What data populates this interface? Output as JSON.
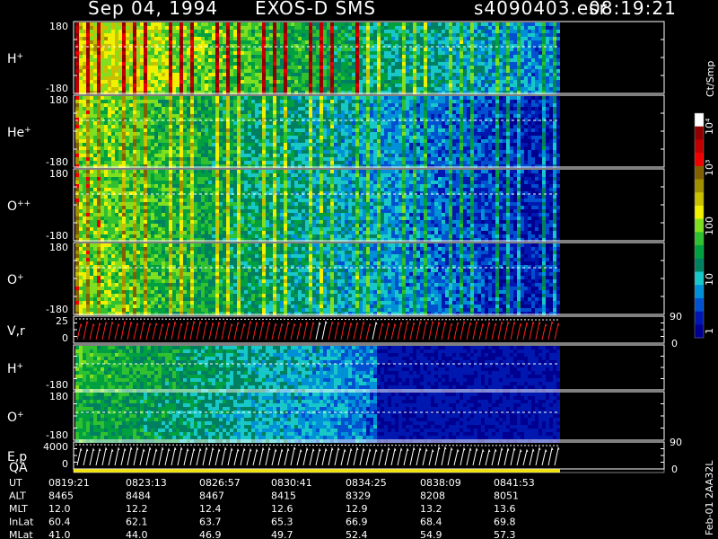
{
  "header": {
    "date": "Sep 04, 1994",
    "mission": "EXOS-D SMS",
    "file": "s4090403.esr",
    "time": "08:19:21"
  },
  "colorbar": {
    "unit": "Ct/Smp",
    "ticks": [
      "10⁴",
      "10³",
      "100",
      "10",
      "1"
    ],
    "colors": [
      "#000090",
      "#0018b0",
      "#0050d0",
      "#0090d8",
      "#18c8c8",
      "#008060",
      "#00a040",
      "#30c030",
      "#80e020",
      "#f0f000",
      "#c8c000",
      "#a09000",
      "#806000",
      "#f00000",
      "#c00000",
      "#900000",
      "#ffffff"
    ]
  },
  "panels": [
    {
      "label": "H",
      "sup": "+",
      "top_tick": "180",
      "bottom_tick": "-180"
    },
    {
      "label": "He",
      "sup": "+",
      "top_tick": "180",
      "bottom_tick": "-180"
    },
    {
      "label": "O",
      "sup": "++",
      "top_tick": "180",
      "bottom_tick": "-180"
    },
    {
      "label": "O",
      "sup": "+",
      "top_tick": "180",
      "bottom_tick": "-180"
    },
    {
      "label": "V,r",
      "sup": "",
      "top_tick": "25",
      "bottom_tick": "0",
      "right_top": "90",
      "right_bottom": "0"
    },
    {
      "label": "H",
      "sup": "+",
      "top_tick": "",
      "bottom_tick": "-180"
    },
    {
      "label": "O",
      "sup": "+",
      "top_tick": "180",
      "bottom_tick": "-180"
    },
    {
      "label": "E,p",
      "sup": "",
      "top_tick": "4000",
      "bottom_tick": "0",
      "right_top": "90",
      "right_bottom": "0"
    }
  ],
  "qa_label": "QA",
  "orbit_table": {
    "rows": [
      {
        "name": "UT",
        "values": [
          "0819:21",
          "0823:13",
          "0826:57",
          "0830:41",
          "0834:25",
          "0838:09",
          "0841:53"
        ]
      },
      {
        "name": "ALT",
        "values": [
          "8465",
          "8484",
          "8467",
          "8415",
          "8329",
          "8208",
          "8051"
        ]
      },
      {
        "name": "MLT",
        "values": [
          "12.0",
          "12.2",
          "12.4",
          "12.6",
          "12.9",
          "13.2",
          "13.6"
        ]
      },
      {
        "name": "InLat",
        "values": [
          "60.4",
          "62.1",
          "63.7",
          "65.3",
          "66.9",
          "68.4",
          "69.8"
        ]
      },
      {
        "name": "MLat",
        "values": [
          "41.0",
          "44.0",
          "46.9",
          "49.7",
          "52.4",
          "54.9",
          "57.3"
        ]
      }
    ]
  },
  "side_note": "Feb-01 2AA32L",
  "chart_data": {
    "type": "heatmap",
    "title": "Sep 04, 1994 EXOS-D SMS",
    "x": [
      "0819:21",
      "0823:13",
      "0826:57",
      "0830:41",
      "0834:25",
      "0838:09",
      "0841:53"
    ],
    "series": [
      {
        "name": "H+",
        "ylim": [
          -180,
          180
        ]
      },
      {
        "name": "He+",
        "ylim": [
          -180,
          180
        ]
      },
      {
        "name": "O++",
        "ylim": [
          -180,
          180
        ]
      },
      {
        "name": "O+",
        "ylim": [
          -180,
          180
        ]
      },
      {
        "name": "V,r",
        "ylim": [
          0,
          25
        ]
      },
      {
        "name": "H+",
        "ylim": [
          -180,
          180
        ]
      },
      {
        "name": "O+",
        "ylim": [
          -180,
          180
        ]
      },
      {
        "name": "E,p",
        "ylim": [
          0,
          4000
        ]
      }
    ],
    "colorscale": {
      "unit": "Ct/Smp",
      "range": [
        1,
        10000
      ],
      "scale": "log"
    }
  }
}
